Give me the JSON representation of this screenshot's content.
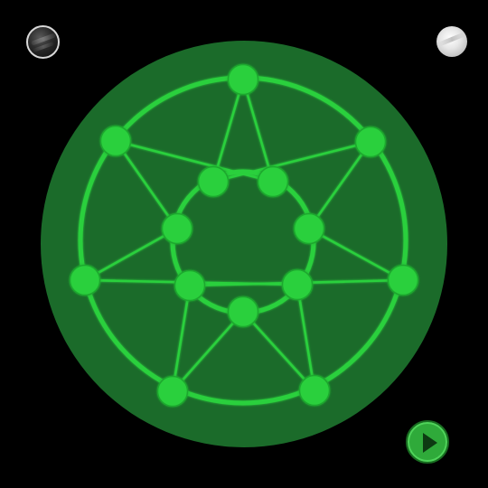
{
  "theme": {
    "background": "#000000",
    "board_fill": "#1b6b2a",
    "line_color": "#2bd03c",
    "node_color": "#2bd03c",
    "node_outline": "#1fa82e",
    "play_button_color": "#2faa3a"
  },
  "controls": {
    "dark_theme_icon": "dark-sphere-icon",
    "light_theme_icon": "light-sphere-icon",
    "play_icon": "play-icon"
  },
  "puzzle": {
    "node_count": 14,
    "edge_count": 28
  }
}
